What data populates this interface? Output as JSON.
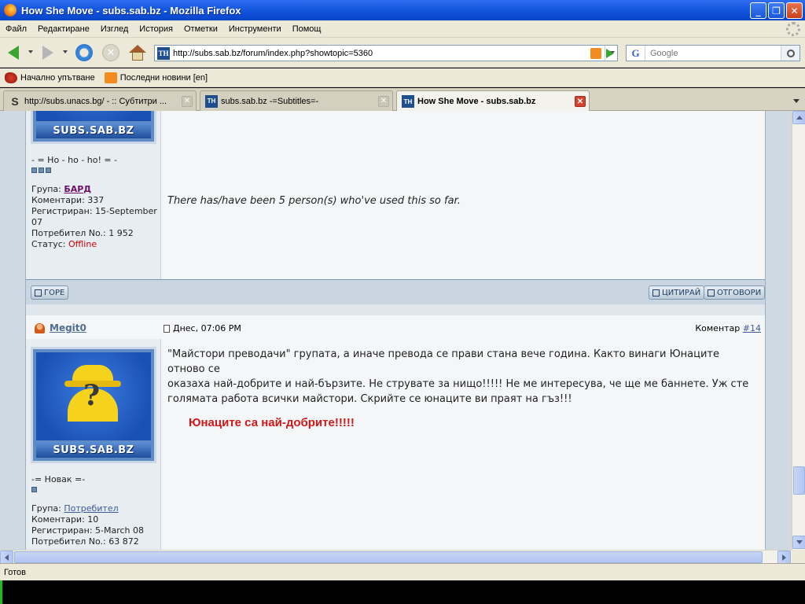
{
  "window": {
    "title": "How She Move - subs.sab.bz - Mozilla Firefox",
    "minimize": "_",
    "maximize": "❐",
    "close": "✕"
  },
  "menu": [
    "Файл",
    "Редактиране",
    "Изглед",
    "История",
    "Отметки",
    "Инструменти",
    "Помощ"
  ],
  "nav": {
    "url": "http://subs.sab.bz/forum/index.php?showtopic=5360",
    "search_placeholder": "Google"
  },
  "bookmarks": [
    {
      "label": "Начално упътване",
      "icon": "firefox-icon"
    },
    {
      "label": "Последни новини [en]",
      "icon": "rss-icon"
    }
  ],
  "tabs": [
    {
      "label": "http://subs.unacs.bg/ - :: Субтитри ...",
      "icon": "unacs-icon",
      "active": false
    },
    {
      "label": "subs.sab.bz -=Subtitles=-",
      "icon": "th-icon",
      "active": false
    },
    {
      "label": "How She Move - subs.sab.bz",
      "icon": "th-icon",
      "active": true
    }
  ],
  "post1": {
    "avatar_brand": "SUBS.SAB.BZ",
    "title": "- = Ho - ho - ho! = -",
    "group_label": "Група:",
    "group": "БАРД",
    "comments": "Коментари: 337",
    "registered": "Регистриран: 15-September 07",
    "user_no": "Потребител No.: 1 952",
    "status_label": "Статус:",
    "status": "Offline",
    "body": "There has/have been 5 person(s) who've used this so far."
  },
  "buttons": {
    "top": "ГОРЕ",
    "quote": "ЦИТИРАЙ",
    "reply": "ОТГОВОРИ"
  },
  "post2": {
    "username": "Megit0",
    "date": "Днес, 07:06 PM",
    "comment_label": "Коментар",
    "comment_num": "#14",
    "avatar_brand": "SUBS.SAB.BZ",
    "title": "-= Новак =-",
    "group_label": "Група:",
    "group": "Потребител",
    "comments": "Коментари: 10",
    "registered": "Регистриран: 5-March 08",
    "user_no": "Потребител No.: 63 872",
    "body_lines": [
      "\"Майстори преводачи\" групата, а иначе превода се прави стана вече година. Както винаги Юнаците отново се",
      "оказаха най-добрите и най-бързите. Не струвате за нищо!!!!! Не ме интересува, че ще ме баннете. Уж сте",
      "голямата работа всички майстори. Скрийте се юнаците ви праят на гъз!!!"
    ],
    "highlight": "Юнаците са най-добрите!!!!!"
  },
  "status": "Готов",
  "colors": {
    "titlebar": "#0b4ad2",
    "chrome": "#ece9d8",
    "forum_bg": "#f4f6f8",
    "highlight_red": "#d01818"
  }
}
